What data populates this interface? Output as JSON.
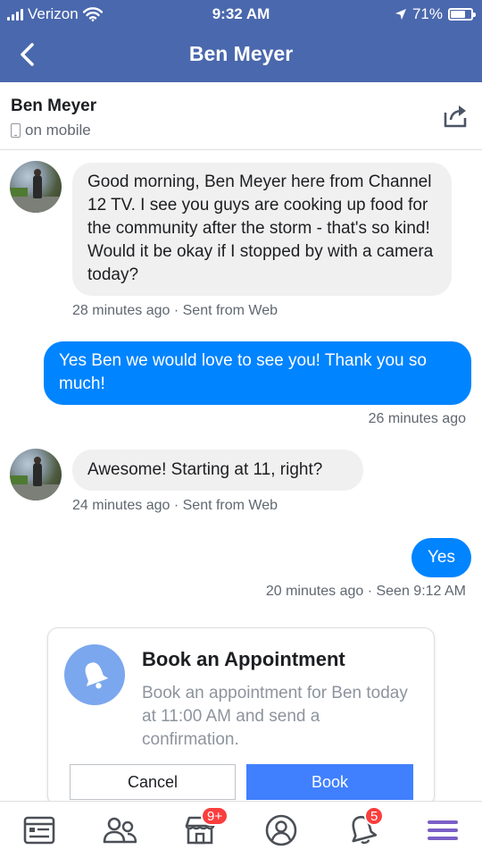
{
  "status_bar": {
    "carrier": "Verizon",
    "time": "9:32 AM",
    "battery_percent": "71%",
    "battery_level": 0.71
  },
  "nav": {
    "title": "Ben Meyer"
  },
  "header": {
    "name": "Ben Meyer",
    "status": "on mobile"
  },
  "messages": [
    {
      "direction": "incoming",
      "text": "Good morning, Ben Meyer here from Channel 12 TV.  I see you guys are cooking up food for the community after the storm - that's so kind!  Would it be okay if I stopped by with a camera today?",
      "meta": "28 minutes ago · Sent from Web"
    },
    {
      "direction": "outgoing",
      "text": "Yes Ben we would love to see you!  Thank you so much!",
      "meta": "26 minutes ago"
    },
    {
      "direction": "incoming",
      "text": "Awesome!  Starting at 11, right?",
      "meta": "24 minutes ago · Sent from Web"
    },
    {
      "direction": "outgoing",
      "text": "Yes",
      "meta": "20 minutes ago · Seen 9:12 AM"
    }
  ],
  "appointment_card": {
    "icon": "bell-icon",
    "title": "Book an Appointment",
    "description": "Book an appointment for Ben today at 11:00 AM and send a confirmation.",
    "cancel_label": "Cancel",
    "book_label": "Book"
  },
  "tab_bar": {
    "tabs": [
      {
        "icon": "news-feed-icon"
      },
      {
        "icon": "friends-icon"
      },
      {
        "icon": "marketplace-icon",
        "badge": "9+"
      },
      {
        "icon": "profile-icon"
      },
      {
        "icon": "notifications-icon",
        "badge": "5"
      },
      {
        "icon": "menu-icon"
      }
    ]
  },
  "colors": {
    "brand": "#4a68ad",
    "outgoing_bubble": "#0084ff",
    "incoming_bubble": "#f1f0f0",
    "book_button": "#4080ff",
    "badge": "#fa3e3e",
    "active_tab": "#7b5fc6"
  }
}
